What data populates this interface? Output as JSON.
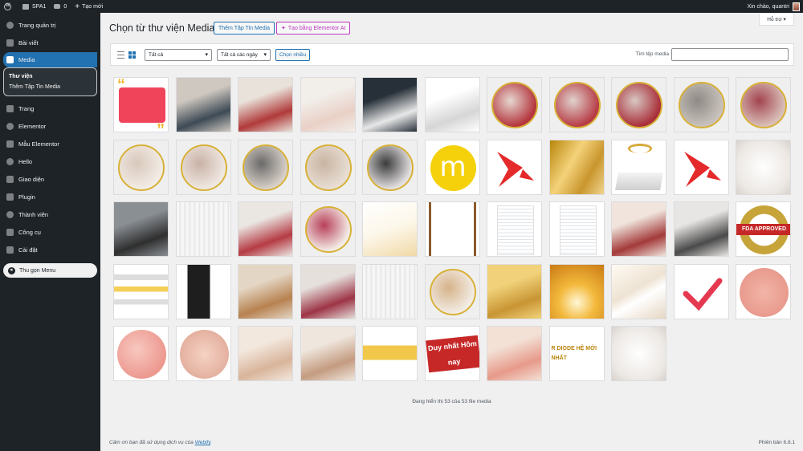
{
  "adminbar": {
    "site_name": "SPA1",
    "comments_count": "0",
    "new_label": "Tạo mới",
    "greeting": "Xin chào, quantri"
  },
  "sidebar": {
    "items": [
      {
        "label": "Trang quản trị",
        "icon": "dashboard-icon"
      },
      {
        "label": "Bài viết",
        "icon": "pin-icon"
      },
      {
        "label": "Media",
        "icon": "media-icon"
      },
      {
        "label": "Trang",
        "icon": "page-icon"
      },
      {
        "label": "Elementor",
        "icon": "elementor-icon"
      },
      {
        "label": "Mẫu Elementor",
        "icon": "folder-icon"
      },
      {
        "label": "Hello",
        "icon": "hello-icon"
      },
      {
        "label": "Giao diện",
        "icon": "brush-icon"
      },
      {
        "label": "Plugin",
        "icon": "plugin-icon"
      },
      {
        "label": "Thành viên",
        "icon": "users-icon"
      },
      {
        "label": "Công cụ",
        "icon": "wrench-icon"
      },
      {
        "label": "Cài đặt",
        "icon": "settings-icon"
      }
    ],
    "submenu": [
      "Thư viện",
      "Thêm Tập Tin Media"
    ],
    "collapse_label": "Thu gọn Menu"
  },
  "header": {
    "help_label": "Hỗ trợ",
    "title": "Chọn từ thư viện Media",
    "add_media_label": "Thêm Tập Tin Media",
    "elementor_ai_label": "Tạo bằng Elementor AI"
  },
  "toolbar": {
    "type_filter": "Tất cả",
    "date_filter": "Tất cả các ngày",
    "bulk_select_label": "Chọn nhiều",
    "search_label": "Tìm tệp media",
    "search_value": ""
  },
  "media_items": [
    {
      "kind": "quote-red"
    },
    {
      "kind": "photo",
      "c": [
        "#cfc8c0",
        "#3d4a55"
      ]
    },
    {
      "kind": "photo",
      "c": [
        "#e9e2da",
        "#b03a3a"
      ]
    },
    {
      "kind": "photo",
      "c": [
        "#f2eeea",
        "#e9d0c6"
      ]
    },
    {
      "kind": "photo",
      "c": [
        "#273039",
        "#e8e8e8"
      ]
    },
    {
      "kind": "photo",
      "c": [
        "#ffffff",
        "#d6d6d6"
      ]
    },
    {
      "kind": "circle",
      "c": [
        "#b4353d",
        "#e6d7d0"
      ]
    },
    {
      "kind": "circle",
      "c": [
        "#b73c46",
        "#e0d2cc"
      ]
    },
    {
      "kind": "circle",
      "c": [
        "#a92f3a",
        "#d8c8c2"
      ]
    },
    {
      "kind": "circle",
      "c": [
        "#c9c2bc",
        "#8f8a86"
      ]
    },
    {
      "kind": "circle",
      "c": [
        "#d9bfb8",
        "#a34450"
      ]
    },
    {
      "kind": "circle",
      "c": [
        "#f2ece6",
        "#d9c8bb"
      ]
    },
    {
      "kind": "circle",
      "c": [
        "#efe8e2",
        "#c9b2a6"
      ]
    },
    {
      "kind": "circle",
      "c": [
        "#d8d0c8",
        "#6a6a6a"
      ]
    },
    {
      "kind": "circle",
      "c": [
        "#e8ded4",
        "#c8b4a2"
      ]
    },
    {
      "kind": "circle",
      "c": [
        "#e3e0e0",
        "#3b3b3b"
      ]
    },
    {
      "kind": "logo-m"
    },
    {
      "kind": "red-shape"
    },
    {
      "kind": "gold"
    },
    {
      "kind": "gift"
    },
    {
      "kind": "red-shape"
    },
    {
      "kind": "soft"
    },
    {
      "kind": "photo",
      "c": [
        "#8a8f94",
        "#2f2f2f"
      ]
    },
    {
      "kind": "lines"
    },
    {
      "kind": "photo",
      "c": [
        "#eae6e2",
        "#b53b44"
      ]
    },
    {
      "kind": "circle",
      "c": [
        "#f3ece6",
        "#b8405a"
      ]
    },
    {
      "kind": "soft-gold"
    },
    {
      "kind": "frame"
    },
    {
      "kind": "doc"
    },
    {
      "kind": "doc"
    },
    {
      "kind": "photo",
      "c": [
        "#f0e4dc",
        "#a33a3a"
      ]
    },
    {
      "kind": "photo",
      "c": [
        "#e8e6e4",
        "#4a4a4a"
      ]
    },
    {
      "kind": "fda",
      "text": "FDA APPROVED"
    },
    {
      "kind": "stripes"
    },
    {
      "kind": "machine"
    },
    {
      "kind": "photo",
      "c": [
        "#e4d6c4",
        "#b78250"
      ]
    },
    {
      "kind": "photo",
      "c": [
        "#e5e0dc",
        "#9d3446"
      ]
    },
    {
      "kind": "lines"
    },
    {
      "kind": "circle",
      "c": [
        "#f2ece4",
        "#d6b38a"
      ]
    },
    {
      "kind": "photo",
      "c": [
        "#f1d27a",
        "#c99534"
      ]
    },
    {
      "kind": "gold-glow"
    },
    {
      "kind": "silk"
    },
    {
      "kind": "check"
    },
    {
      "kind": "skin"
    },
    {
      "kind": "skin2"
    },
    {
      "kind": "skin3"
    },
    {
      "kind": "photo",
      "c": [
        "#f3e8de",
        "#d8b49a"
      ]
    },
    {
      "kind": "photo",
      "c": [
        "#efe6dd",
        "#c49b80"
      ]
    },
    {
      "kind": "gold-band"
    },
    {
      "kind": "badge",
      "text": "Duy nhất Hôm nay"
    },
    {
      "kind": "photo",
      "c": [
        "#f3e1d6",
        "#e79a8a"
      ]
    },
    {
      "kind": "diode",
      "text": "R DIODE HỆ MỚI NHẤT"
    },
    {
      "kind": "soft"
    }
  ],
  "status_text": "Đang hiển thị 53 của 53 file media",
  "footer": {
    "thanks_text": "Cảm ơn bạn đã sử dụng dịch vụ của ",
    "link_text": "Webify",
    "version": "Phiên bản 6.8.1"
  }
}
